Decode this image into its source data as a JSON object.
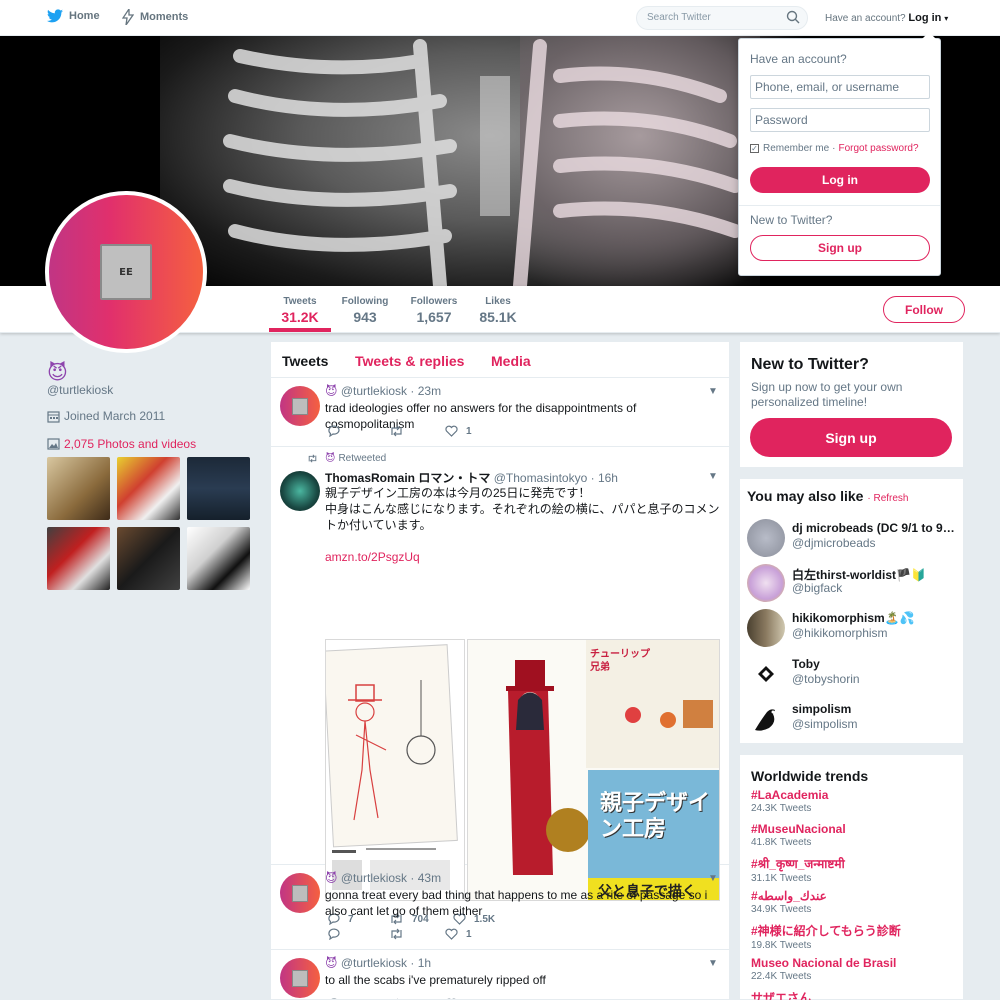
{
  "nav": {
    "home": "Home",
    "moments": "Moments",
    "search_placeholder": "Search Twitter",
    "have_account": "Have an account?",
    "login": "Log in"
  },
  "colors": {
    "accent": "#e0245e",
    "twitter_blue": "#1da1f2",
    "bg": "#e6ecf0"
  },
  "profile": {
    "chip_text": "EE",
    "emoji": "😈",
    "handle": "@turtlekiosk",
    "joined": "Joined March 2011",
    "photos_link": "2,075 Photos and videos",
    "follow": "Follow",
    "stats": [
      {
        "label": "Tweets",
        "value": "31.2K"
      },
      {
        "label": "Following",
        "value": "943"
      },
      {
        "label": "Followers",
        "value": "1,657"
      },
      {
        "label": "Likes",
        "value": "85.1K"
      }
    ]
  },
  "timeline": {
    "tabs": [
      "Tweets",
      "Tweets & replies",
      "Media"
    ],
    "tweets": [
      {
        "emoji": "😈",
        "handle": "@turtlekiosk",
        "time": "· 23m",
        "text": "trad ideologies offer no answers for the disappointments of cosmopolitanism",
        "replies": "",
        "retweets": "",
        "likes": "1"
      },
      {
        "retweeted": "Retweeted",
        "name": "ThomasRomain ロマン・トマ",
        "handle": "@Thomasintokyo",
        "time": "· 16h",
        "text_1": "親子デザイン工房の本は今月の25日に発売です！",
        "text_2": "中身はこんな感じになります。それぞれの絵の横に、パパと息子のコメントか付いています。",
        "link": "amzn.to/2PsgzUq",
        "book_title": "親子デザイン工房",
        "book_sub": "父と息子で描く",
        "tulip": "チューリップ兄弟",
        "replies": "7",
        "retweets": "704",
        "likes": "1.5K"
      },
      {
        "emoji": "😈",
        "handle": "@turtlekiosk",
        "time": "· 43m",
        "text": "gonna treat every bad thing that happens to me as a rite of passage so i also cant let go of them either",
        "replies": "",
        "retweets": "",
        "likes": "1"
      },
      {
        "emoji": "😈",
        "handle": "@turtlekiosk",
        "time": "· 1h",
        "text": "to all the scabs i've prematurely ripped off"
      }
    ]
  },
  "login_dropdown": {
    "have_account": "Have an account?",
    "phone_placeholder": "Phone, email, or username",
    "password_placeholder": "Password",
    "remember": "Remember me",
    "dot": "·",
    "forgot": "Forgot password?",
    "login": "Log in",
    "new_to_twitter": "New to Twitter?",
    "signup": "Sign up"
  },
  "sidebar": {
    "new_title": "New to Twitter?",
    "new_sub": "Sign up now to get your own personalized timeline!",
    "signup": "Sign up",
    "wtf_title": "You may also like",
    "refresh": "· Refresh",
    "wtf": [
      {
        "name": "dj microbeads (DC 9/1 to 9…",
        "handle": "@djmicrobeads"
      },
      {
        "name": "白左thirst-worldist🏴🔰",
        "handle": "@bigfack"
      },
      {
        "name": "hikikomorphism🏝️💦",
        "handle": "@hikikomorphism"
      },
      {
        "name": "Toby",
        "handle": "@tobyshorin"
      },
      {
        "name": "simpolism",
        "handle": "@simpolism"
      }
    ],
    "trends_title": "Worldwide trends",
    "trends": [
      {
        "tag": "#LaAcademia",
        "count": "24.3K Tweets"
      },
      {
        "tag": "#MuseuNacional",
        "count": "41.8K Tweets"
      },
      {
        "tag": "#श्री_कृष्ण_जन्माष्टमी",
        "count": "31.1K Tweets"
      },
      {
        "tag": "#عندك_واسطه",
        "count": "34.9K Tweets"
      },
      {
        "tag": "#神様に紹介してもらう診断",
        "count": "19.8K Tweets"
      },
      {
        "tag": "Museo Nacional de Brasil",
        "count": "22.4K Tweets"
      },
      {
        "tag": "サザエさん",
        "count": ""
      }
    ]
  }
}
